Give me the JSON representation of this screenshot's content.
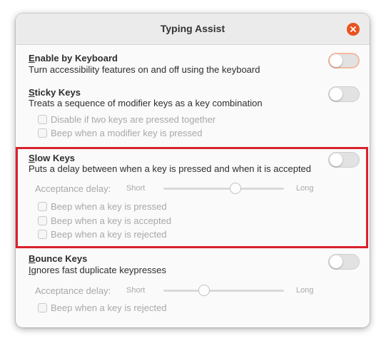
{
  "window": {
    "title": "Typing Assist",
    "accent_color": "#e95420",
    "highlight_color": "#d9222b"
  },
  "enable_by_keyboard": {
    "title_mnemonic": "E",
    "title_rest": "nable by Keyboard",
    "description": "Turn accessibility features on and off using the keyboard",
    "enabled": false
  },
  "sticky_keys": {
    "title_mnemonic": "S",
    "title_rest": "ticky Keys",
    "description": "Treats a sequence of modifier keys as a key combination",
    "enabled": false,
    "options": [
      {
        "label": "Disable if two keys are pressed together",
        "checked": false
      },
      {
        "label": "Beep when a modifier key is pressed",
        "checked": false
      }
    ]
  },
  "slow_keys": {
    "title_mnemonic": "S",
    "title_rest": "low Keys",
    "description": "Puts a delay between when a key is pressed and when it is accepted",
    "enabled": false,
    "acceptance_delay_label": "Acceptance delay:",
    "short_label": "Short",
    "long_label": "Long",
    "delay_fraction": 0.6,
    "options": [
      {
        "label": "Beep when a key is pressed",
        "checked": false
      },
      {
        "label": "Beep when a key is accepted",
        "checked": false
      },
      {
        "label": "Beep when a key is rejected",
        "checked": false
      }
    ]
  },
  "bounce_keys": {
    "title_mnemonic": "B",
    "title_rest": "ounce Keys",
    "description_mnemonic": "I",
    "description_rest": "gnores fast duplicate keypresses",
    "enabled": false,
    "acceptance_delay_label": "Acceptance delay:",
    "short_label": "Short",
    "long_label": "Long",
    "delay_fraction": 0.34,
    "options": [
      {
        "label": "Beep when a key is rejected",
        "checked": false
      }
    ]
  }
}
